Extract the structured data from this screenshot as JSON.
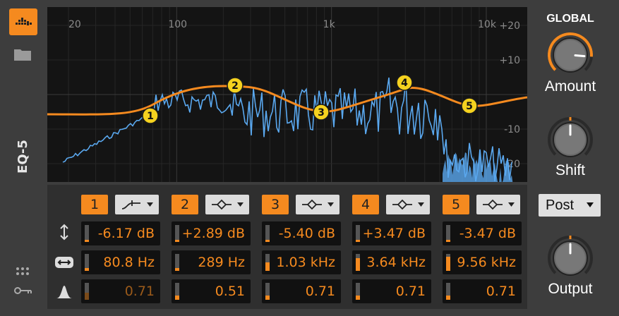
{
  "device": {
    "name": "EQ-5"
  },
  "left_rail": {
    "device_icon": "eq-device-icon",
    "folder_icon": "folder-icon",
    "dots_icon": "grid-dots-icon",
    "key_icon": "key-icon"
  },
  "graph": {
    "freq_labels": [
      "20",
      "100",
      "1k",
      "10k"
    ],
    "db_labels": [
      "+20",
      "+10",
      "-10",
      "-20"
    ],
    "node_labels": [
      "1",
      "2",
      "3",
      "4",
      "5"
    ],
    "curve_color": "#f58a1f",
    "spectrum_color": "#5aa8ef",
    "node_color": "#f5d21f"
  },
  "bands": [
    {
      "number": "1",
      "shape_icon": "low-cut-shape-icon",
      "gain": "-6.17 dB",
      "freq": "80.8 Hz",
      "q": "0.71",
      "gain_level": 0.12,
      "freq_level": 0.15,
      "q_level": 0.4
    },
    {
      "number": "2",
      "shape_icon": "bell-shape-icon",
      "gain": "+2.89 dB",
      "freq": "289 Hz",
      "q": "0.51",
      "gain_level": 0.12,
      "freq_level": 0.15,
      "q_level": 0.25
    },
    {
      "number": "3",
      "shape_icon": "bell-shape-icon",
      "gain": "-5.40 dB",
      "freq": "1.03 kHz",
      "q": "0.71",
      "gain_level": 0.12,
      "freq_level": 0.5,
      "q_level": 0.25
    },
    {
      "number": "4",
      "shape_icon": "bell-shape-icon",
      "gain": "+3.47 dB",
      "freq": "3.64 kHz",
      "q": "0.71",
      "gain_level": 0.12,
      "freq_level": 0.75,
      "q_level": 0.25
    },
    {
      "number": "5",
      "shape_icon": "bell-shape-icon",
      "gain": "-3.47 dB",
      "freq": "9.56 kHz",
      "q": "0.71",
      "gain_level": 0.12,
      "freq_level": 0.85,
      "q_level": 0.25
    }
  ],
  "row_icons": [
    "gain-updown-icon",
    "frequency-arrows-icon",
    "q-bell-icon"
  ],
  "right_panel": {
    "global_label": "GLOBAL",
    "amount_label": "Amount",
    "shift_label": "Shift",
    "mode_value": "Post",
    "output_label": "Output",
    "amount_level": 0.85,
    "shift_level": 0.5,
    "output_level": 0.5
  }
}
